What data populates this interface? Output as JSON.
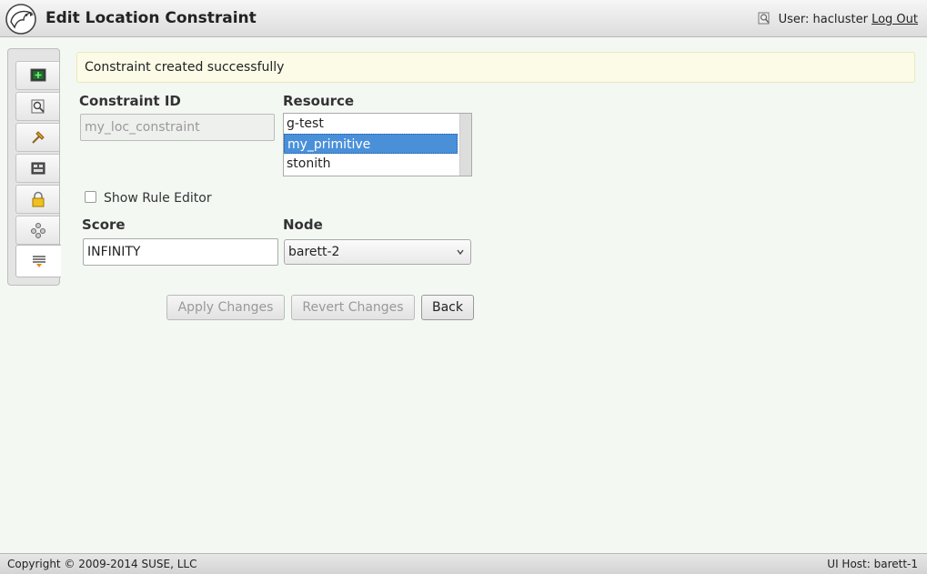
{
  "header": {
    "title": "Edit Location Constraint",
    "user_label": "User: hacluster",
    "logout_label": "Log Out"
  },
  "sidebar": {
    "items": [
      {
        "icon": "monitor-icon",
        "active": false
      },
      {
        "icon": "explore-icon",
        "active": false
      },
      {
        "icon": "config-tools-icon",
        "active": false
      },
      {
        "icon": "simulator-icon",
        "active": false
      },
      {
        "icon": "lock-icon",
        "active": false
      },
      {
        "icon": "cluster-icon",
        "active": false
      },
      {
        "icon": "constraints-icon",
        "active": true
      }
    ]
  },
  "flash": {
    "message": "Constraint created successfully"
  },
  "form": {
    "constraint_id_label": "Constraint ID",
    "constraint_id_value": "my_loc_constraint",
    "resource_label": "Resource",
    "resource_options": [
      "g-test",
      "my_primitive",
      "stonith"
    ],
    "resource_selected": "my_primitive",
    "show_rule_editor_label": "Show Rule Editor",
    "show_rule_editor_checked": false,
    "score_label": "Score",
    "score_value": "INFINITY",
    "node_label": "Node",
    "node_value": "barett-2"
  },
  "actions": {
    "apply_label": "Apply Changes",
    "revert_label": "Revert Changes",
    "back_label": "Back"
  },
  "footer": {
    "copyright": "Copyright © 2009-2014 SUSE, LLC",
    "ui_host": "UI Host: barett-1"
  },
  "colors": {
    "background": "#f3f8f3",
    "selection": "#4a90d9",
    "flash_background": "#fbfbe8"
  }
}
